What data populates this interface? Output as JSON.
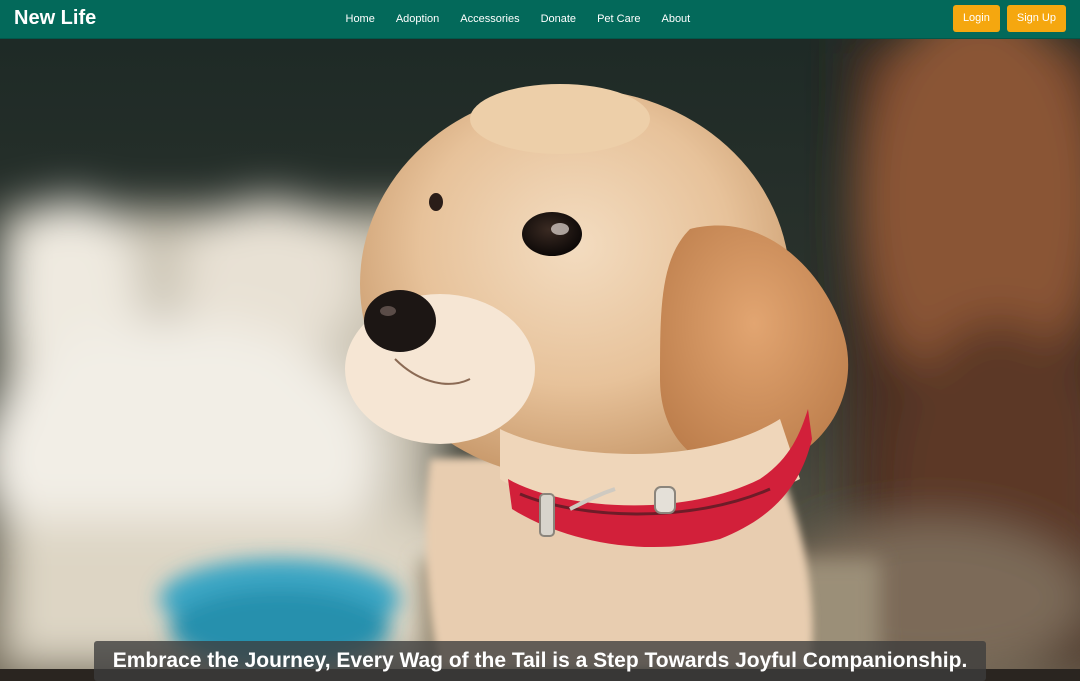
{
  "brand": {
    "name": "New Life"
  },
  "nav": {
    "links": [
      "Home",
      "Adoption",
      "Accessories",
      "Donate",
      "Pet Care",
      "About"
    ]
  },
  "auth": {
    "login_label": "Login",
    "signup_label": "Sign Up"
  },
  "hero": {
    "image_subject": "puppy-photo",
    "tagline": "Embrace the Journey, Every Wag of the Tail is a Step Towards Joyful Companionship."
  },
  "colors": {
    "navbar": "#03695a",
    "button": "#f5a70f",
    "collar": "#d2203a"
  }
}
